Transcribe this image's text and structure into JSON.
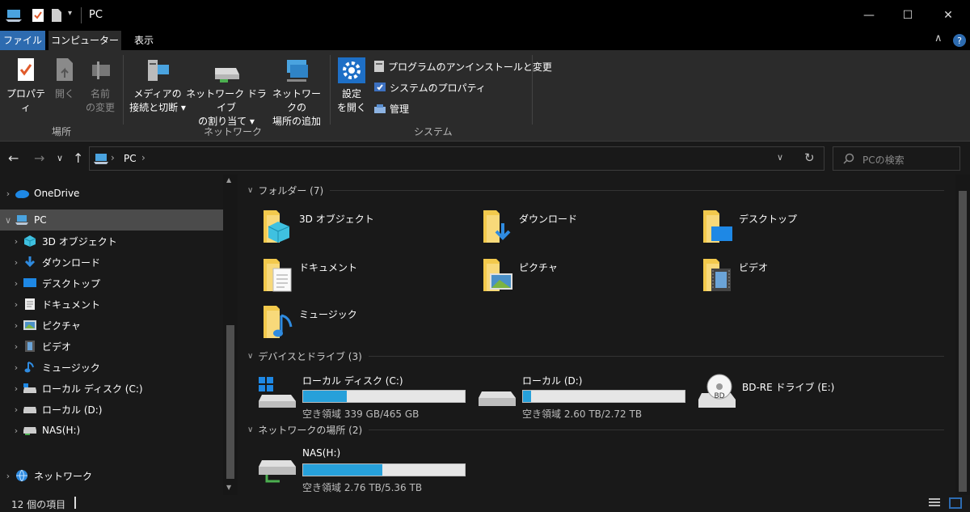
{
  "window": {
    "title": "PC",
    "minimize": "—",
    "maximize": "☐",
    "close": "✕"
  },
  "ribbon_tabs": {
    "file": "ファイル",
    "computer": "コンピューター",
    "view": "表示"
  },
  "ribbon": {
    "location": {
      "label": "場所",
      "properties": "プロパティ",
      "open": "開く",
      "rename_1": "名前",
      "rename_2": "の変更"
    },
    "network": {
      "label": "ネットワーク",
      "media_1": "メディアの",
      "media_2": "接続と切断 ▾",
      "map_drive_1": "ネットワーク ドライブ",
      "map_drive_2": "の割り当て ▾",
      "add_location_1": "ネットワークの",
      "add_location_2": "場所の追加"
    },
    "system": {
      "label": "システム",
      "settings_1": "設定",
      "settings_2": "を開く",
      "uninstall": "プログラムのアンインストールと変更",
      "system_properties": "システムのプロパティ",
      "manage": "管理"
    }
  },
  "address": {
    "path": "PC",
    "search_placeholder": "PCの検索"
  },
  "nav": {
    "onedrive": "OneDrive",
    "pc": "PC",
    "objects3d": "3D オブジェクト",
    "downloads": "ダウンロード",
    "desktop": "デスクトップ",
    "documents": "ドキュメント",
    "pictures": "ピクチャ",
    "videos": "ビデオ",
    "music": "ミュージック",
    "local_c": "ローカル ディスク (C:)",
    "local_d": "ローカル (D:)",
    "nas": "NAS(H:)",
    "network": "ネットワーク"
  },
  "sections": {
    "folders": "フォルダー (7)",
    "devices": "デバイスとドライブ (3)",
    "network_locations": "ネットワークの場所 (2)"
  },
  "folders": {
    "objects3d": "3D オブジェクト",
    "downloads": "ダウンロード",
    "desktop": "デスクトップ",
    "documents": "ドキュメント",
    "pictures": "ピクチャ",
    "videos": "ビデオ",
    "music": "ミュージック"
  },
  "drives": {
    "c": {
      "name": "ローカル ディスク (C:)",
      "free": "空き領域 339 GB/465 GB",
      "used_fraction": 0.27
    },
    "d": {
      "name": "ローカル (D:)",
      "free": "空き領域 2.60 TB/2.72 TB",
      "used_fraction": 0.05
    },
    "e": {
      "name": "BD-RE ドライブ (E:)"
    },
    "h": {
      "name": "NAS(H:)",
      "free": "空き領域 2.76 TB/5.36 TB",
      "used_fraction": 0.49
    }
  },
  "status": {
    "item_count": "12 個の項目"
  },
  "colors": {
    "accent": "#2d6bb0",
    "bar_fill": "#26a0da",
    "folder": "#f2c94c"
  }
}
